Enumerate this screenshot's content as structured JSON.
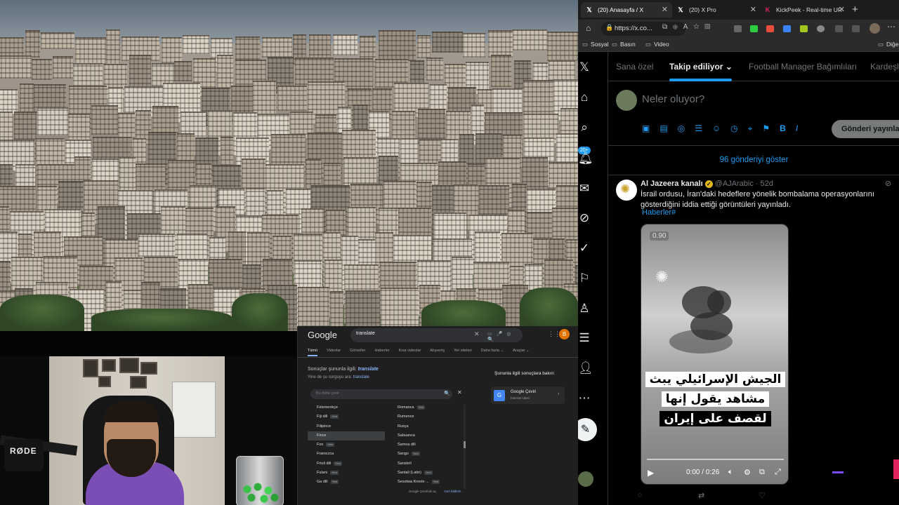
{
  "browser": {
    "tabs": [
      {
        "label": "(20) Anasayfa / X",
        "icon": "x-logo-icon",
        "active": true
      },
      {
        "label": "(20) X Pro",
        "icon": "x-logo-icon",
        "active": false
      },
      {
        "label": "KickPeek - Real-time UR",
        "icon": "kickpeek-icon",
        "active": false
      }
    ],
    "url": "https://x.co...",
    "bookmarks": [
      "Sosyal",
      "Basın",
      "Video",
      "Diğe"
    ]
  },
  "x": {
    "tabs": [
      "Sana özel",
      "Takip ediliyor",
      "Football Manager Bağımlıları",
      "Kardeşl"
    ],
    "notification_badge": "20+",
    "composer_placeholder": "Neler oluyor?",
    "post_button": "Gönderi yayınla",
    "show_posts": "96 gönderiyi göster",
    "tweet": {
      "author": "Al Jazeera kanalı",
      "handle": "@AJArabic",
      "time": "52d",
      "text": "İsrail ordusu, İran'daki hedeflere yönelik bombalama operasyonlarını gösterdiğini iddia ettiği görüntüleri yayınladı.",
      "hashtag": "Haberler#",
      "video": {
        "speed": "0.90",
        "caption_lines": [
          "الجيش الإسرائيلي يبث",
          "مشاهد يقول إنها",
          "لقصف على إيران"
        ],
        "time": "0:00 / 0:26"
      }
    }
  },
  "google": {
    "logo": "Google",
    "query": "translate",
    "tabs": [
      "Tümü",
      "Videolar",
      "Görseller",
      "Haberler",
      "Kısa videolar",
      "Alışveriş",
      "Yer siteleri",
      "Daha fazla ⌄",
      "Araçlar ⌄"
    ],
    "showing_results_label": "Sonuçlar şununla ilgili:",
    "showing_results_term": "translate",
    "search_instead_label": "Yine de şu sorguyu ara:",
    "search_instead_term": "translate",
    "lang_search_placeholder": "Bu dilde çevir",
    "languages_left": [
      {
        "name": "Felemenkçe",
        "new": ""
      },
      {
        "name": "Fiji dili",
        "new": "Yeni"
      },
      {
        "name": "Filipince",
        "new": ""
      },
      {
        "name": "Fince",
        "new": "",
        "highlight": true
      },
      {
        "name": "Fon",
        "new": "Yeni"
      },
      {
        "name": "Fransızca",
        "new": ""
      },
      {
        "name": "Friuli dili",
        "new": "Yeni"
      },
      {
        "name": "Fulani",
        "new": "Yeni"
      },
      {
        "name": "Ga dili",
        "new": "Yeni"
      }
    ],
    "languages_right": [
      {
        "name": "Romanca",
        "new": "Yeni"
      },
      {
        "name": "Rumence",
        "new": ""
      },
      {
        "name": "Rusça",
        "new": ""
      },
      {
        "name": "Sabuanca",
        "new": ""
      },
      {
        "name": "Samoa dili",
        "new": ""
      },
      {
        "name": "Sango",
        "new": "Yeni"
      },
      {
        "name": "Sanskrit",
        "new": ""
      },
      {
        "name": "Santali (Latin)",
        "new": "Yeni"
      },
      {
        "name": "Sesotwa Kreole ...",
        "new": "Yeni"
      }
    ],
    "related_title": "Şununla ilgili sonuçlara bakın:",
    "related_card_name": "Google Çeviri",
    "related_card_sub": "İnternet sitesi",
    "footer_left": "Google Çeviri'de aç",
    "footer_right": "Geri bildirim"
  },
  "webcam": {
    "mic_brand": "RØDE"
  }
}
